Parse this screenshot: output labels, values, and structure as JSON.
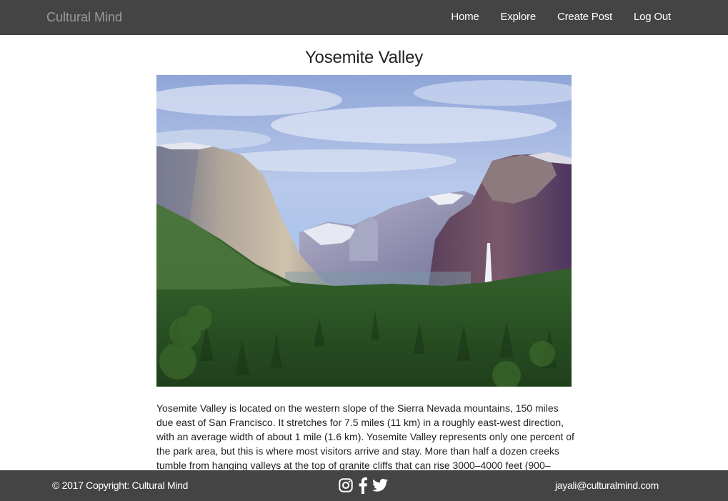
{
  "navbar": {
    "brand": "Cultural Mind",
    "links": [
      {
        "label": "Home"
      },
      {
        "label": "Explore"
      },
      {
        "label": "Create Post"
      },
      {
        "label": "Log Out"
      }
    ]
  },
  "post": {
    "title": "Yosemite Valley",
    "body": "Yosemite Valley is located on the western slope of the Sierra Nevada mountains, 150 miles due east of San Francisco. It stretches for 7.5 miles (11 km) in a roughly east-west direction, with an average width of about 1 mile (1.6 km). Yosemite Valley represents only one percent of the park area, but this is where most visitors arrive and stay. More than half a dozen creeks tumble from hanging valleys at the top of granite cliffs that can rise 3000–4000 feet (900–"
  },
  "footer": {
    "copyright": "© 2017 Copyright: Cultural Mind",
    "email": "jayali@culturalmind.com",
    "social_icons": [
      "instagram-icon",
      "facebook-icon",
      "twitter-icon"
    ]
  },
  "colors": {
    "navbar_bg": "#444444",
    "footer_bg": "#444444",
    "brand_text": "#9a9a9a",
    "link_text": "#ffffff"
  }
}
